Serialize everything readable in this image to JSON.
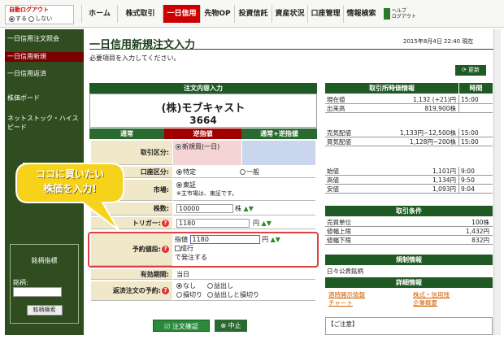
{
  "header": {
    "logout_label": "自動ログアウト",
    "opt_on": "する",
    "opt_off": "しない",
    "tabs": [
      "ホーム",
      "株式取引",
      "一日信用",
      "先物OP",
      "投資信託",
      "資産状況",
      "口座管理",
      "情報検索"
    ],
    "help_label": "ヘルプ",
    "logout_btn": "ログアウト"
  },
  "sidebar": {
    "items": [
      "一日信用注文照会",
      "一日信用新規",
      "一日信用返済",
      "株価ボード",
      "ネットストック・ハイスピード"
    ],
    "search_title": "銘柄指標",
    "search_label": "銘柄:",
    "search_button": "銘柄検索"
  },
  "page": {
    "title": "一日信用新規注文入力",
    "subtitle": "必要項目を入力してください。",
    "datetime": "2015年8月4日 22:40 現在",
    "refresh": "更新"
  },
  "order": {
    "header": "注文内容入力",
    "stock_name": "(株)モブキャスト",
    "code": "3664",
    "tabs": [
      "通常",
      "逆指値",
      "通常+逆指値"
    ],
    "trade_label": "取引区分:",
    "trade_value": "新規買(一日)",
    "account_label": "口座区分:",
    "account_opt1": "特定",
    "account_opt2": "一般",
    "market_label": "市場:",
    "market_value": "東証",
    "market_note": "※主市場は、東証です。",
    "qty_label": "株数:",
    "qty_value": "10000",
    "qty_unit": "株",
    "trigger_label": "トリガー:",
    "trigger_value": "1180",
    "yen": "円",
    "price_label": "予約値段:",
    "price_mode": "指値",
    "price_value": "1180",
    "opt_market": "成行",
    "opt_issue": "で発注する",
    "validity_label": "有効期間:",
    "validity_value": "当日",
    "repay_label": "返済注文の予約:",
    "repay_opts": [
      "なし",
      "益出し",
      "損切り",
      "益出しと損切り"
    ],
    "confirm": "注文確認",
    "cancel": "中止"
  },
  "callout": {
    "line1": "ココに買いたい",
    "line2": "株価を入力!"
  },
  "quote": {
    "header": "取引所時価情報",
    "time_header": "時間",
    "rows": [
      [
        "現在値",
        "1,132 (+21)円",
        "15:00"
      ],
      [
        "出来高",
        "819,900株",
        ""
      ],
      [
        "売気配値",
        "1,133円~12,500株",
        "15:00"
      ],
      [
        "買気配値",
        "1,128円~200株",
        "15:00"
      ],
      [
        "始値",
        "1,101円",
        "9:00"
      ],
      [
        "高値",
        "1,134円",
        "9:50"
      ],
      [
        "安値",
        "1,093円",
        "9:04"
      ]
    ],
    "cond_header": "取引条件",
    "cond": [
      [
        "売買単位",
        "100株"
      ],
      [
        "値幅上限",
        "1,432円"
      ],
      [
        "値幅下限",
        "832円"
      ]
    ],
    "reg_header": "規制情報",
    "reg_value": "日々公表銘柄",
    "detail_header": "詳細情報",
    "links": [
      "適時開示情報",
      "チャート",
      "株式・信用残",
      "企業概要"
    ],
    "notes": "【ご注意】"
  }
}
